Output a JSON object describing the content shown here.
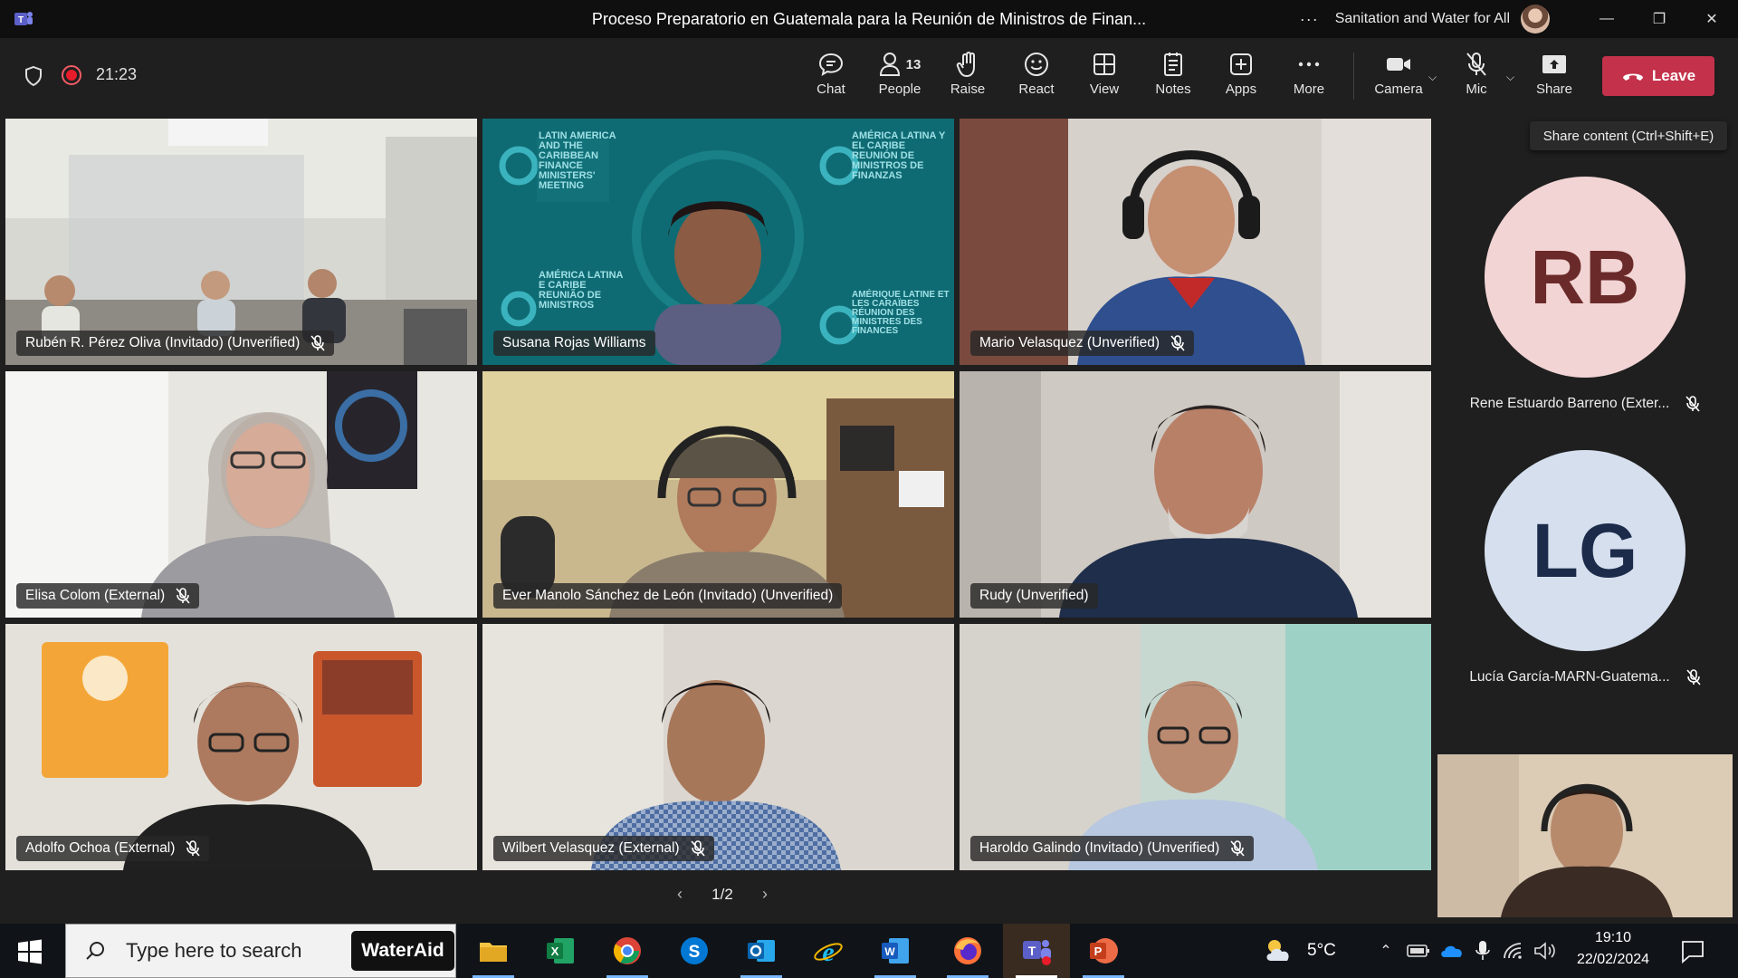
{
  "window": {
    "title": "Proceso Preparatorio en Guatemala para la Reunión de Ministros de Finan...",
    "more": "···",
    "org": "Sanitation and Water for All",
    "minimize": "—",
    "restore": "❐",
    "close": "✕"
  },
  "meeting": {
    "timer": "21:23",
    "toolbar": {
      "chat": "Chat",
      "people": "People",
      "people_count": "13",
      "raise": "Raise",
      "react": "React",
      "view": "View",
      "notes": "Notes",
      "apps": "Apps",
      "more": "More",
      "camera": "Camera",
      "mic": "Mic",
      "share": "Share",
      "leave": "Leave"
    },
    "tooltip": "Share content (Ctrl+Shift+E)",
    "participants": [
      {
        "name": "Rubén R. Pérez Oliva (Invitado) (Unverified)",
        "muted": true
      },
      {
        "name": "Susana Rojas Williams",
        "muted": false
      },
      {
        "name": "Mario Velasquez (Unverified)",
        "muted": true
      },
      {
        "name": "Elisa Colom (External)",
        "muted": true
      },
      {
        "name": "Ever Manolo Sánchez de León (Invitado) (Unverified)",
        "muted": false
      },
      {
        "name": "Rudy (Unverified)",
        "muted": false
      },
      {
        "name": "Adolfo Ochoa (External)",
        "muted": true
      },
      {
        "name": "Wilbert Velasquez (External)",
        "muted": true
      },
      {
        "name": "Haroldo Galindo (Invitado) (Unverified)",
        "muted": true
      }
    ],
    "pager": {
      "label": "1/2",
      "prev": "‹",
      "next": "›"
    },
    "roster": [
      {
        "initials": "RB",
        "name": "Rene Estuardo Barreno (Exter...",
        "bg": "#f2d4d4",
        "fg": "#6b2a2a"
      },
      {
        "initials": "LG",
        "name": "Lucía García-MARN-Guatema...",
        "bg": "#d5dfee",
        "fg": "#1c2b4a"
      }
    ],
    "backdrop_text": {
      "left_top": "LATIN AMERICA AND THE CARIBBEAN FINANCE MINISTERS' MEETING",
      "right_top": "AMÉRICA LATINA Y EL CARIBE REUNIÓN DE MINISTROS DE FINANZAS",
      "left_bottom": "AMÉRICA LATINA E CARIBE REUNIÃO DE MINISTROS",
      "right_bottom": "AMÉRIQUE LATINE ET LES CARAÏBES RÉUNION DES MINISTRES DES FINANCES"
    }
  },
  "taskbar": {
    "search_placeholder": "Type here to search",
    "wateraid": "WaterAid",
    "weather": "5°C",
    "time": "19:10",
    "date": "22/02/2024"
  },
  "colors": {
    "accent": "#7f85f5",
    "leave": "#c4314b",
    "toolbar_bg": "#1f1f1f",
    "titlebar_bg": "#0f0f0f"
  }
}
